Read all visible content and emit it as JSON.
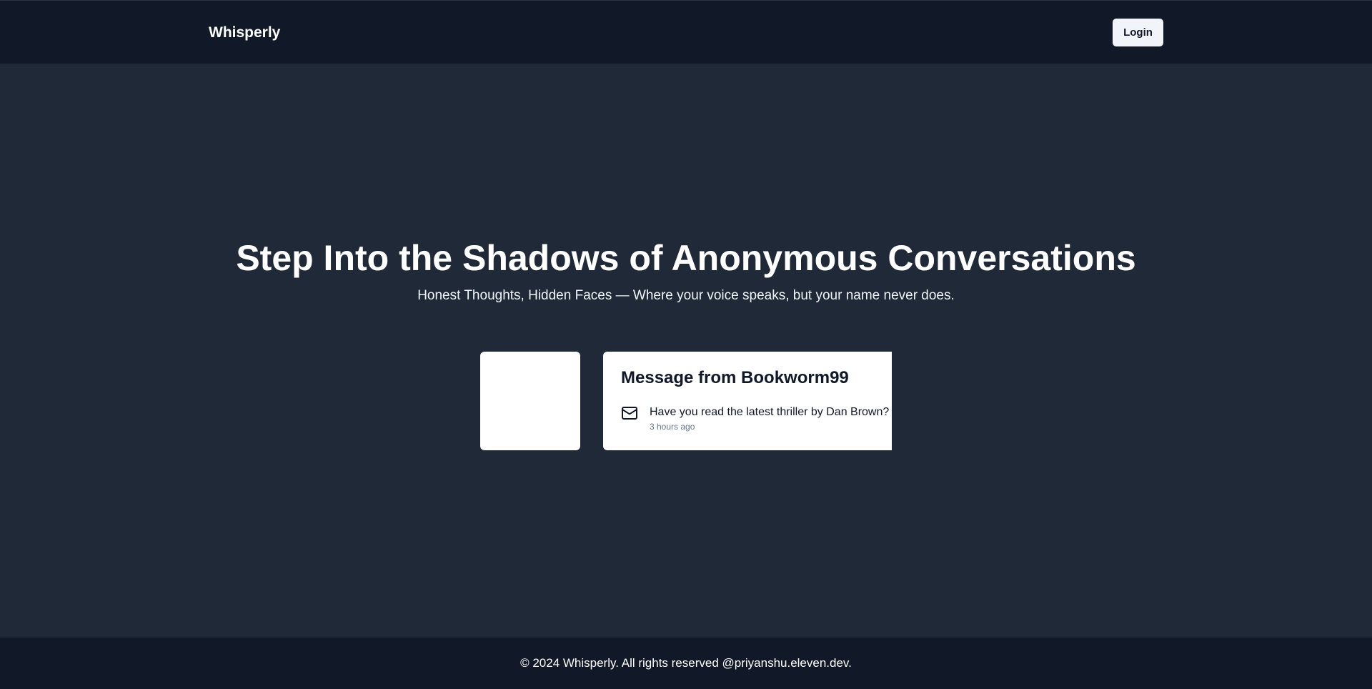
{
  "navbar": {
    "brand": "Whisperly",
    "login_label": "Login"
  },
  "hero": {
    "title": "Step Into the Shadows of Anonymous Conversations",
    "subtitle": "Honest Thoughts, Hidden Faces — Where your voice speaks, but your name never does."
  },
  "carousel": {
    "current_card": {
      "title": "Message from Bookworm99",
      "icon": "mail-icon",
      "content": "Have you read the latest thriller by Dan Brown?",
      "time": "3 hours ago"
    }
  },
  "footer": {
    "text": "© 2024 Whisperly. All rights reserved @priyanshu.eleven.dev."
  },
  "colors": {
    "navbar_bg": "#111827",
    "hero_bg": "#1f2937",
    "card_bg": "#ffffff",
    "button_bg": "#f1f5f9"
  }
}
